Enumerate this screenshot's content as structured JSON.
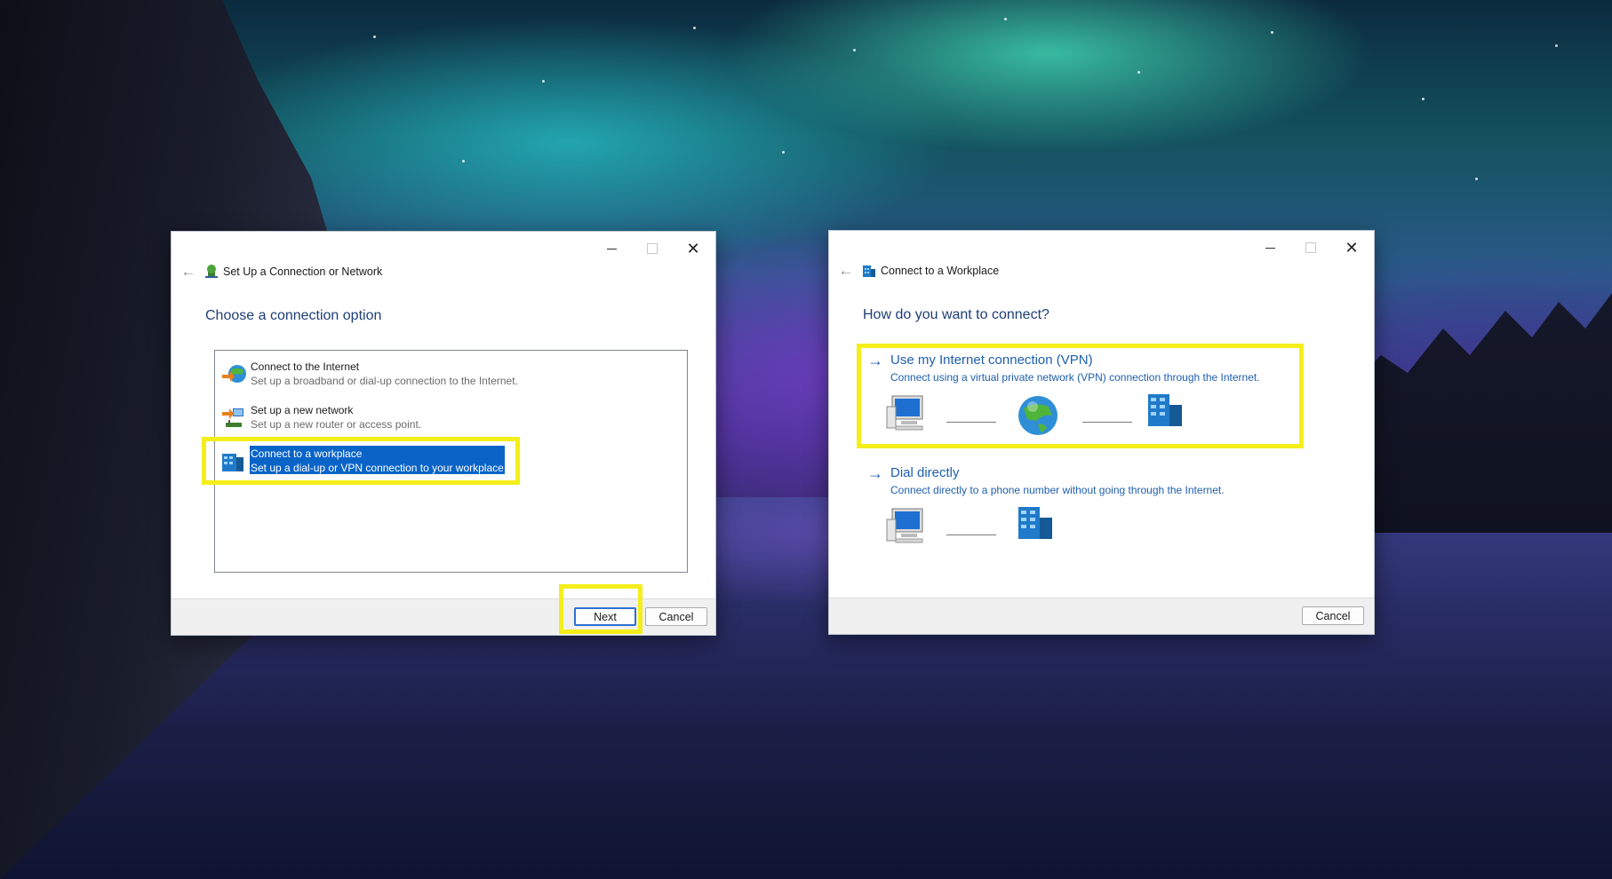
{
  "left_window": {
    "title": "Set Up a Connection or Network",
    "heading": "Choose a connection option",
    "options": [
      {
        "title": "Connect to the Internet",
        "desc": "Set up a broadband or dial-up connection to the Internet."
      },
      {
        "title": "Set up a new network",
        "desc": "Set up a new router or access point."
      },
      {
        "title": "Connect to a workplace",
        "desc": "Set up a dial-up or VPN connection to your workplace."
      }
    ],
    "next_label": "Next",
    "cancel_label": "Cancel"
  },
  "right_window": {
    "title": "Connect to a Workplace",
    "heading": "How do you want to connect?",
    "choices": [
      {
        "title": "Use my Internet connection (VPN)",
        "desc": "Connect using a virtual private network (VPN) connection through the Internet."
      },
      {
        "title": "Dial directly",
        "desc": "Connect directly to a phone number without going through the Internet."
      }
    ],
    "cancel_label": "Cancel"
  },
  "caption": {
    "minimize": "–",
    "maximize": "□",
    "close": "✕"
  },
  "colors": {
    "highlight": "#f4ee1a",
    "selection": "#0a64c8",
    "link": "#1e5fae",
    "heading": "#1e3f76"
  },
  "icons": [
    "back-arrow-icon",
    "network-setup-icon",
    "workplace-icon",
    "globe-icon",
    "router-icon",
    "computer-icon",
    "office-building-icon",
    "arrow-right-icon"
  ]
}
